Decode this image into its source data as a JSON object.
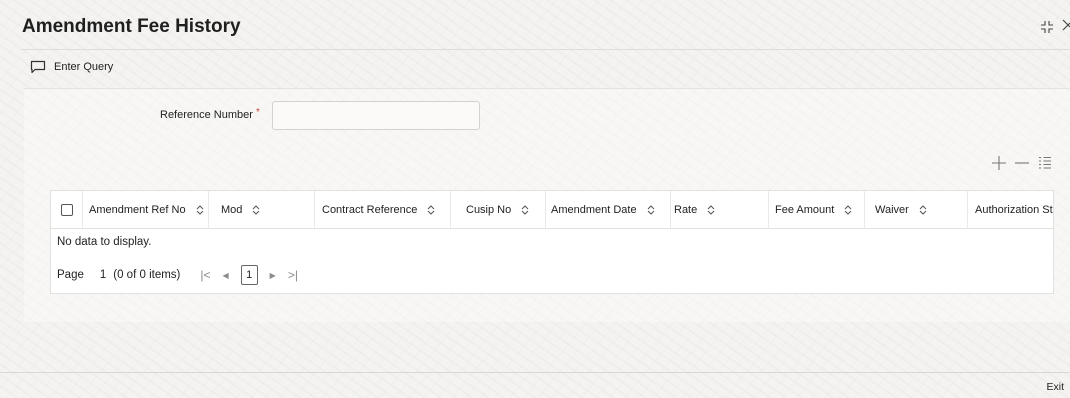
{
  "window": {
    "title": "Amendment Fee History",
    "maximize_icon": "expand-corners-icon",
    "close_icon": "close-icon"
  },
  "toolbar": {
    "enter_query_label": "Enter Query",
    "enter_query_icon": "chat-bubble-icon"
  },
  "form": {
    "reference_number": {
      "label": "Reference Number",
      "required_marker": "*",
      "value": "",
      "placeholder": ""
    }
  },
  "grid": {
    "tools": [
      "add-row-icon",
      "delete-row-icon",
      "column-settings-icon"
    ],
    "columns": [
      "Amendment Ref No",
      "Mod",
      "Contract Reference",
      "Cusip No",
      "Amendment Date",
      "Rate",
      "Fee Amount",
      "Waiver",
      "Authorization Sta"
    ],
    "rows": [],
    "empty_message": "No data to display.",
    "pagination": {
      "page_label": "Page",
      "page_number": "1",
      "item_count": "(0 of 0 items)",
      "current_page": "1"
    }
  },
  "footer": {
    "exit_label": "Exit"
  },
  "colors": {
    "required": "#c74634",
    "background": "#f4f3f1",
    "grid_border": "#e3e1dd"
  }
}
